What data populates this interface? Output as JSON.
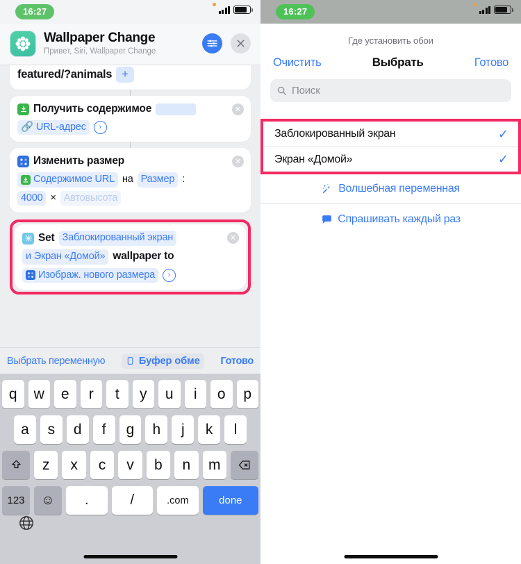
{
  "left": {
    "status": {
      "time": "16:27"
    },
    "header": {
      "app_title": "Wallpaper Change",
      "app_subtitle": "Привет, Siri, Wallpaper Change",
      "settings_icon": "sliders-icon",
      "close_icon": "close-icon"
    },
    "flow": {
      "card_url": {
        "text": "featured/?animals",
        "add_label": "+"
      },
      "card_get_contents": {
        "title": "Получить содержимое",
        "chip_url": "URL-адрес"
      },
      "card_resize": {
        "title": "Изменить размер",
        "chip_source": "Содержимое URL",
        "word_na": "на",
        "chip_size": "Размер",
        "colon": ":",
        "value_width": "4000",
        "times": "×",
        "chip_autoheight": "Автовысота"
      },
      "card_set_wallpaper": {
        "word_set": "Set",
        "chip_lock": "Заблокированный экран",
        "chip_home": "и Экран «Домой»",
        "word_wallpaper_to": "wallpaper to",
        "chip_resized": "Изображ. нового размера"
      }
    },
    "keyboard_toolbar": {
      "select_variable": "Выбрать переменную",
      "clipboard": "Буфер обме",
      "done": "Готово",
      "clipboard_icon": "clipboard-icon"
    },
    "keyboard": {
      "row1": [
        "q",
        "w",
        "e",
        "r",
        "t",
        "y",
        "u",
        "i",
        "o",
        "p"
      ],
      "row2": [
        "a",
        "s",
        "d",
        "f",
        "g",
        "h",
        "j",
        "k",
        "l"
      ],
      "row3": [
        "z",
        "x",
        "c",
        "v",
        "b",
        "n",
        "m"
      ],
      "shift_icon": "shift-icon",
      "backspace_icon": "backspace-icon",
      "numbers_key": "123",
      "emoji_key": "emoji-icon",
      "period_key": ".",
      "slash_key": "/",
      "dotcom_key": ".com",
      "return_key": "done",
      "globe_icon": "globe-icon"
    }
  },
  "right": {
    "status": {
      "time": "16:27"
    },
    "sheet": {
      "title": "Где установить обои",
      "nav_left": "Очистить",
      "nav_title": "Выбрать",
      "nav_right": "Готово",
      "search_placeholder": "Поиск",
      "search_icon": "search-icon",
      "options": [
        {
          "label": "Заблокированный экран",
          "checked": "✓"
        },
        {
          "label": "Экран «Домой»",
          "checked": "✓"
        }
      ],
      "extra": [
        {
          "label": "Волшебная переменная",
          "icon": "magic-wand-icon"
        },
        {
          "label": "Спрашивать каждый раз",
          "icon": "chat-bubble-icon"
        }
      ]
    }
  },
  "colors": {
    "highlight": "#f32a63",
    "accent_blue": "#3a7bf6",
    "green": "#5ec269"
  }
}
